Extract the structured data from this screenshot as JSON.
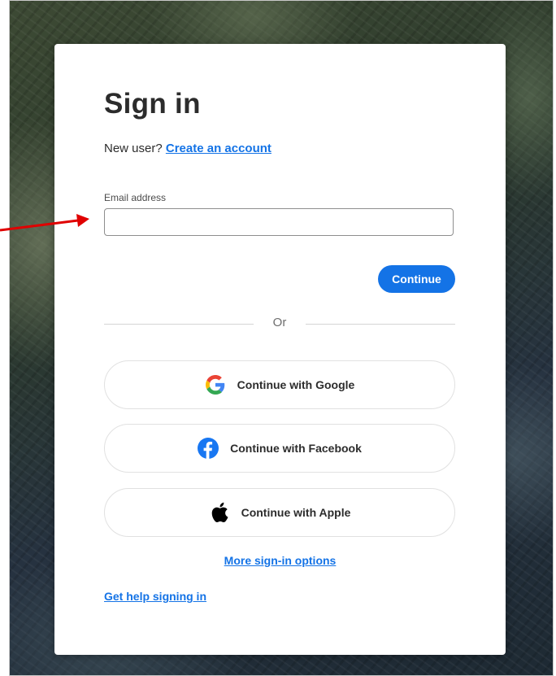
{
  "signin": {
    "title": "Sign in",
    "new_user_text": "New user?",
    "create_account_link": "Create an account",
    "email_label": "Email address",
    "email_value": "",
    "email_placeholder": "",
    "continue_label": "Continue",
    "or_text": "Or",
    "google_label": "Continue with Google",
    "facebook_label": "Continue with Facebook",
    "apple_label": "Continue with Apple",
    "more_options_link": "More sign-in options",
    "help_link": "Get help signing in"
  },
  "colors": {
    "accent": "#1473e6",
    "annotation_arrow": "#e00000",
    "facebook": "#1877f2"
  },
  "icons": {
    "google": "google-icon",
    "facebook": "facebook-icon",
    "apple": "apple-icon",
    "arrow": "red-arrow-icon"
  }
}
